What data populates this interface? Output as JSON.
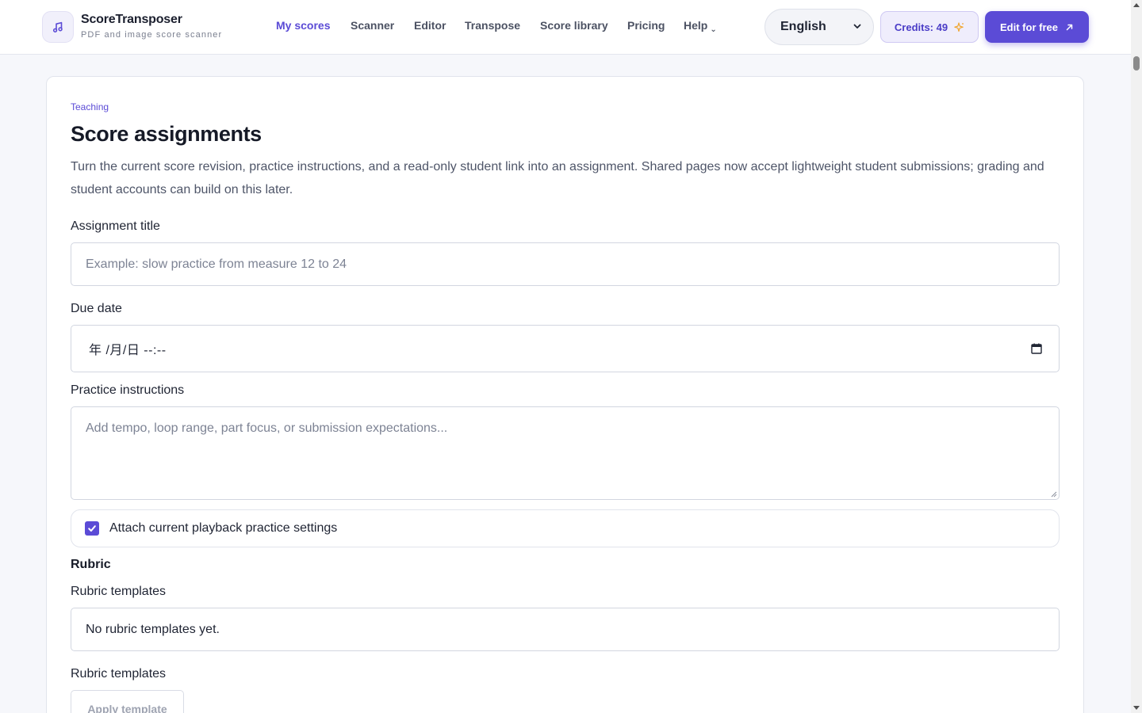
{
  "brand": {
    "name": "ScoreTransposer",
    "tagline": "PDF and image score scanner"
  },
  "nav": {
    "items": [
      {
        "label": "My scores",
        "active": true
      },
      {
        "label": "Scanner"
      },
      {
        "label": "Editor"
      },
      {
        "label": "Transpose"
      },
      {
        "label": "Score library"
      },
      {
        "label": "Pricing"
      },
      {
        "label": "Help",
        "has_dropdown": true
      }
    ],
    "help_caret": "⌄"
  },
  "header": {
    "language": "English",
    "credits_label": "Credits: 49",
    "credits_icon": "sparkle-icon",
    "cta_label": "Edit for free",
    "cta_icon": "arrow-up-right-icon"
  },
  "page": {
    "eyebrow": "Teaching",
    "title": "Score assignments",
    "description": "Turn the current score revision, practice instructions, and a read-only student link into an assignment. Shared pages now accept lightweight student submissions; grading and student accounts can build on this later."
  },
  "form": {
    "title_label": "Assignment title",
    "title_placeholder": "Example: slow practice from measure 12 to 24",
    "due_label": "Due date",
    "due_value": "年 /月/日 --:--",
    "instructions_label": "Practice instructions",
    "instructions_placeholder": "Add tempo, loop range, part focus, or submission expectations...",
    "attach_label": "Attach current playback practice settings",
    "attach_checked": true,
    "rubric_heading": "Rubric",
    "rubric_templates_label": "Rubric templates",
    "rubric_templates_value": "No rubric templates yet.",
    "rubric_templates_label_2": "Rubric templates",
    "apply_template_label": "Apply template"
  },
  "colors": {
    "accent": "#5b4bd6",
    "accent_soft": "#efedfc",
    "spark": "#f0a632"
  }
}
